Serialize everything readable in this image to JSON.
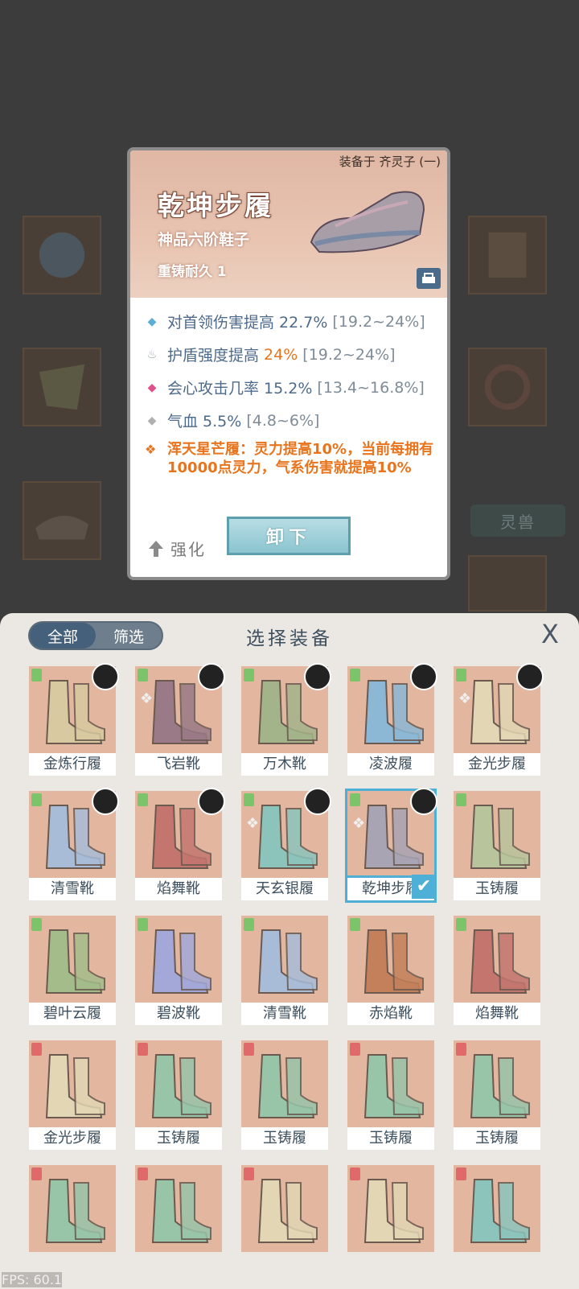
{
  "tooltip": {
    "equipped_by": "装备于 齐灵子 (一)",
    "title": "乾坤步履",
    "subtitle": "神品六阶鞋子",
    "durability": "重铸耐久 1",
    "stats": [
      {
        "icon": "blue-diamond-icon",
        "color": "#5aaed8",
        "label": "对首领伤害提高 22.7%",
        "range": "[19.2~24%]"
      },
      {
        "icon": "shield-flame-icon",
        "color": "#9aa4ae",
        "label_prefix": "护盾强度提高 ",
        "label_highlight": "24%",
        "range": "[19.2~24%]"
      },
      {
        "icon": "pink-diamond-icon",
        "color": "#e0508a",
        "label": "会心攻击几率 15.2%",
        "range": "[13.4~16.8%]"
      },
      {
        "icon": "gray-diamond-icon",
        "color": "#b0b0b0",
        "label": "气血 5.5%",
        "range": "[4.8~6%]"
      }
    ],
    "set_effect": "浑天星芒履：灵力提高10%，当前每拥有10000点灵力，气系伤害就提高10%",
    "strengthen_label": "强化",
    "unequip_label": "卸下"
  },
  "background": {
    "spirit_beast_label": "灵兽"
  },
  "panel": {
    "tabs": [
      "全部",
      "筛选"
    ],
    "title": "选择装备",
    "close_label": "X"
  },
  "items": [
    {
      "name": "金炼行履",
      "tier": "green",
      "avatar": true,
      "mark": false,
      "chip": false,
      "palette": "#d8c9a0"
    },
    {
      "name": "飞岩靴",
      "tier": "green",
      "avatar": true,
      "mark": true,
      "chip": false,
      "palette": "#9a7a86"
    },
    {
      "name": "万木靴",
      "tier": "green",
      "avatar": true,
      "mark": false,
      "chip": false,
      "palette": "#a4b48a"
    },
    {
      "name": "凌波履",
      "tier": "green",
      "avatar": true,
      "mark": false,
      "chip": false,
      "palette": "#8cb8d6"
    },
    {
      "name": "金光步履",
      "tier": "green",
      "avatar": true,
      "mark": true,
      "chip": true,
      "palette": "#e2d6b4"
    },
    {
      "name": "清雪靴",
      "tier": "green",
      "avatar": true,
      "mark": false,
      "chip": false,
      "palette": "#a8bcd8"
    },
    {
      "name": "焰舞靴",
      "tier": "green",
      "avatar": true,
      "mark": false,
      "chip": false,
      "palette": "#c4766e"
    },
    {
      "name": "天玄银履",
      "tier": "green",
      "avatar": true,
      "mark": true,
      "chip": true,
      "palette": "#8cc4bc"
    },
    {
      "name": "乾坤步履",
      "tier": "green",
      "avatar": true,
      "mark": true,
      "chip": true,
      "palette": "#a9a4b4",
      "selected": true
    },
    {
      "name": "玉铸履",
      "tier": "green",
      "avatar": false,
      "mark": false,
      "chip": false,
      "palette": "#b8c49c"
    },
    {
      "name": "碧叶云履",
      "tier": "green",
      "avatar": false,
      "mark": false,
      "chip": true,
      "palette": "#a4bc8a"
    },
    {
      "name": "碧波靴",
      "tier": "green",
      "avatar": false,
      "mark": false,
      "chip": false,
      "palette": "#a4a8d8"
    },
    {
      "name": "清雪靴",
      "tier": "green",
      "avatar": false,
      "mark": false,
      "chip": true,
      "palette": "#a8bcd8"
    },
    {
      "name": "赤焰靴",
      "tier": "green",
      "avatar": false,
      "mark": false,
      "chip": false,
      "palette": "#c4805a"
    },
    {
      "name": "焰舞靴",
      "tier": "green",
      "avatar": false,
      "mark": false,
      "chip": false,
      "palette": "#c4766e"
    },
    {
      "name": "金光步履",
      "tier": "red",
      "avatar": false,
      "mark": false,
      "chip": false,
      "palette": "#e2d6b4"
    },
    {
      "name": "玉铸履",
      "tier": "red",
      "avatar": false,
      "mark": false,
      "chip": false,
      "palette": "#98c4a8"
    },
    {
      "name": "玉铸履",
      "tier": "red",
      "avatar": false,
      "mark": false,
      "chip": false,
      "palette": "#98c4a8"
    },
    {
      "name": "玉铸履",
      "tier": "red",
      "avatar": false,
      "mark": false,
      "chip": false,
      "palette": "#98c4a8"
    },
    {
      "name": "玉铸履",
      "tier": "red",
      "avatar": false,
      "mark": false,
      "chip": false,
      "palette": "#98c4a8"
    },
    {
      "name": "",
      "tier": "red",
      "avatar": false,
      "mark": false,
      "chip": false,
      "palette": "#98c4a8"
    },
    {
      "name": "",
      "tier": "red",
      "avatar": false,
      "mark": false,
      "chip": false,
      "palette": "#98c4a8"
    },
    {
      "name": "",
      "tier": "red",
      "avatar": false,
      "mark": false,
      "chip": false,
      "palette": "#e2d6b4"
    },
    {
      "name": "",
      "tier": "red",
      "avatar": false,
      "mark": false,
      "chip": false,
      "palette": "#e2d6b4"
    },
    {
      "name": "",
      "tier": "red",
      "avatar": false,
      "mark": false,
      "chip": false,
      "palette": "#8cc4bc"
    }
  ],
  "fps": "FPS: 60.1"
}
